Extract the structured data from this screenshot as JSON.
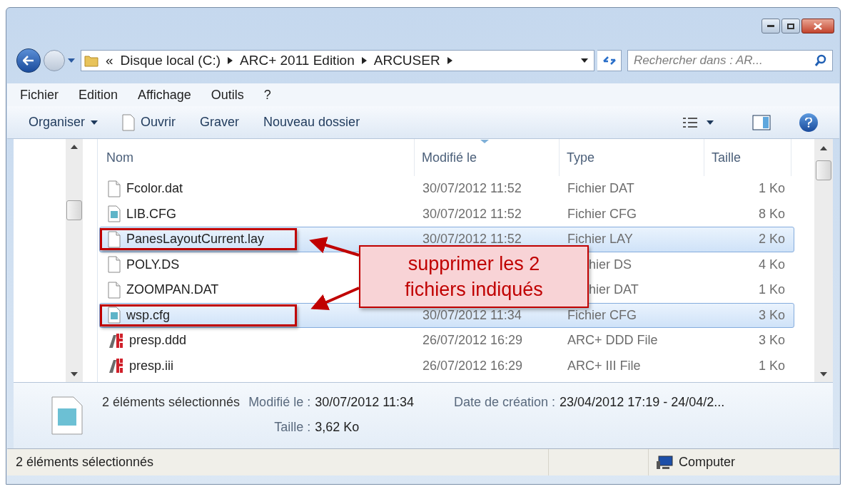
{
  "address": {
    "overflow": "«",
    "segments": [
      "Disque local (C:)",
      "ARC+ 2011 Edition",
      "ARCUSER"
    ]
  },
  "search": {
    "placeholder": "Rechercher dans : AR..."
  },
  "menu": [
    "Fichier",
    "Edition",
    "Affichage",
    "Outils",
    "?"
  ],
  "toolbar": [
    {
      "label": "Organiser",
      "kind": "dropdown"
    },
    {
      "label": "Ouvrir",
      "kind": "file"
    },
    {
      "label": "Graver",
      "kind": "plain"
    },
    {
      "label": "Nouveau dossier",
      "kind": "plain"
    }
  ],
  "columns": [
    {
      "label": "Nom",
      "sorted": false
    },
    {
      "label": "Modifié le",
      "sorted": true
    },
    {
      "label": "Type",
      "sorted": false
    },
    {
      "label": "Taille",
      "sorted": false
    }
  ],
  "rows": [
    {
      "kind": "blank",
      "name": "Fcolor.dat",
      "modified": "30/07/2012 11:52",
      "type": "Fichier DAT",
      "size": "1 Ko",
      "selected": false,
      "marked": false
    },
    {
      "kind": "cfg",
      "name": "LIB.CFG",
      "modified": "30/07/2012 11:52",
      "type": "Fichier CFG",
      "size": "8 Ko",
      "selected": false,
      "marked": false
    },
    {
      "kind": "blank",
      "name": "PanesLayoutCurrent.lay",
      "modified": "30/07/2012 11:52",
      "type": "Fichier LAY",
      "size": "2 Ko",
      "selected": true,
      "marked": true
    },
    {
      "kind": "blank",
      "name": "POLY.DS",
      "modified": "",
      "type": "hier DS",
      "size": "4 Ko",
      "selected": false,
      "marked": false
    },
    {
      "kind": "blank",
      "name": "ZOOMPAN.DAT",
      "modified": "",
      "type": "hier DAT",
      "size": "1 Ko",
      "selected": false,
      "marked": false
    },
    {
      "kind": "cfg",
      "name": "wsp.cfg",
      "modified": "30/07/2012 11:34",
      "type": "Fichier CFG",
      "size": "3 Ko",
      "selected": true,
      "marked": true
    },
    {
      "kind": "arc",
      "name": "presp.ddd",
      "modified": "26/07/2012 16:29",
      "type": "ARC+ DDD File",
      "size": "3 Ko",
      "selected": false,
      "marked": false
    },
    {
      "kind": "arc",
      "name": "presp.iii",
      "modified": "26/07/2012 16:29",
      "type": "ARC+ III File",
      "size": "1 Ko",
      "selected": false,
      "marked": false
    }
  ],
  "callout": {
    "text": "supprimer les 2\nfichiers indiqués"
  },
  "details": {
    "summary": "2 éléments sélectionnés",
    "fields": [
      {
        "label": "Modifié le :",
        "value": "30/07/2012 11:34"
      },
      {
        "label": "Taille :",
        "value": "3,62 Ko"
      },
      {
        "label": "Date de création :",
        "value": "23/04/2012 17:19 - 24/04/2..."
      }
    ]
  },
  "status_bar": {
    "left": "2 éléments sélectionnés",
    "right": "Computer"
  }
}
